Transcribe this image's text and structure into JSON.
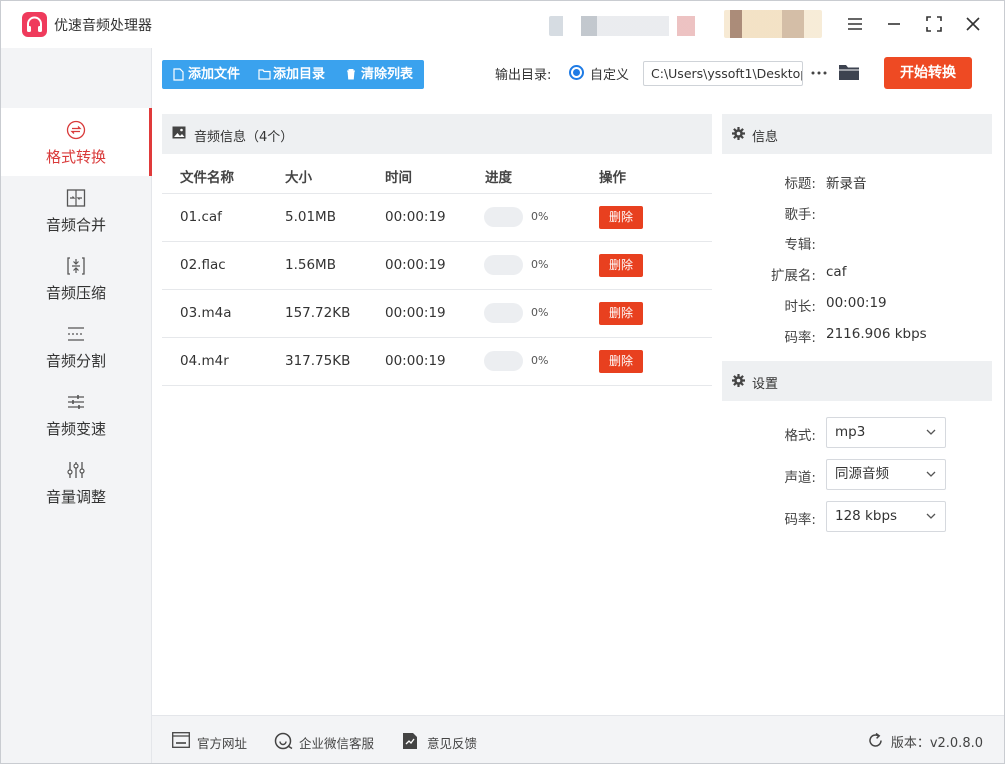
{
  "app": {
    "title": "优速音频处理器"
  },
  "sidebar": {
    "items": [
      {
        "label": "格式转换",
        "icon": "convert-icon",
        "active": true
      },
      {
        "label": "音频合并",
        "icon": "merge-icon"
      },
      {
        "label": "音频压缩",
        "icon": "compress-icon"
      },
      {
        "label": "音频分割",
        "icon": "split-icon"
      },
      {
        "label": "音频变速",
        "icon": "speed-icon"
      },
      {
        "label": "音量调整",
        "icon": "volume-icon"
      }
    ]
  },
  "toolbar": {
    "add_file": "添加文件",
    "add_folder": "添加目录",
    "clear_list": "清除列表",
    "output_label": "输出目录:",
    "custom_label": "自定义",
    "output_path": "C:\\Users\\yssoft1\\Desktop",
    "start_button": "开始转换"
  },
  "list": {
    "title": "音频信息（4个）",
    "columns": {
      "name": "文件名称",
      "size": "大小",
      "time": "时间",
      "progress": "进度",
      "action": "操作"
    },
    "rows": [
      {
        "name": "01.caf",
        "size": "5.01MB",
        "time": "00:00:19",
        "progress": "0%",
        "action": "删除"
      },
      {
        "name": "02.flac",
        "size": "1.56MB",
        "time": "00:00:19",
        "progress": "0%",
        "action": "删除"
      },
      {
        "name": "03.m4a",
        "size": "157.72KB",
        "time": "00:00:19",
        "progress": "0%",
        "action": "删除"
      },
      {
        "name": "04.m4r",
        "size": "317.75KB",
        "time": "00:00:19",
        "progress": "0%",
        "action": "删除"
      }
    ]
  },
  "info": {
    "title": "信息",
    "fields": [
      {
        "label": "标题:",
        "value": "新录音"
      },
      {
        "label": "歌手:",
        "value": ""
      },
      {
        "label": "专辑:",
        "value": ""
      },
      {
        "label": "扩展名:",
        "value": "caf"
      },
      {
        "label": "时长:",
        "value": "00:00:19"
      },
      {
        "label": "码率:",
        "value": "2116.906 kbps"
      }
    ]
  },
  "settings": {
    "title": "设置",
    "format_label": "格式:",
    "format_value": "mp3",
    "channel_label": "声道:",
    "channel_value": "同源音频",
    "bitrate_label": "码率:",
    "bitrate_value": "128 kbps"
  },
  "footer": {
    "website": "官方网址",
    "wechat": "企业微信客服",
    "feedback": "意见反馈",
    "version": "版本：v2.0.8.0"
  },
  "colors": {
    "accent": "#ee4a23",
    "toolbar_blue": "#3aa2ee",
    "active_red": "#d93a3a"
  }
}
